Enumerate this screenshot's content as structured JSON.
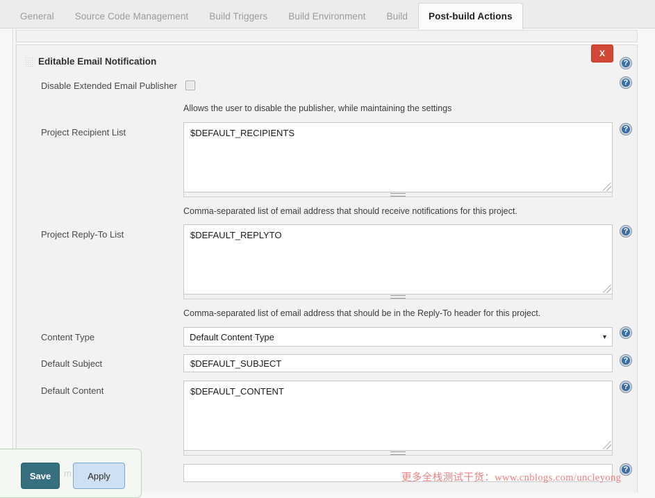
{
  "tabs": [
    {
      "label": "General",
      "active": false
    },
    {
      "label": "Source Code Management",
      "active": false
    },
    {
      "label": "Build Triggers",
      "active": false
    },
    {
      "label": "Build Environment",
      "active": false
    },
    {
      "label": "Build",
      "active": false
    },
    {
      "label": "Post-build Actions",
      "active": true
    }
  ],
  "panel": {
    "title": "Editable Email Notification",
    "delete_label": "X"
  },
  "fields": {
    "disable_publisher": {
      "label": "Disable Extended Email Publisher",
      "checked": false,
      "description": "Allows the user to disable the publisher, while maintaining the settings"
    },
    "project_recipient_list": {
      "label": "Project Recipient List",
      "value": "$DEFAULT_RECIPIENTS",
      "description": "Comma-separated list of email address that should receive notifications for this project."
    },
    "project_reply_to_list": {
      "label": "Project Reply-To List",
      "value": "$DEFAULT_REPLYTO",
      "description": "Comma-separated list of email address that should be in the Reply-To header for this project."
    },
    "content_type": {
      "label": "Content Type",
      "selected": "Default Content Type",
      "arrow": "▼"
    },
    "default_subject": {
      "label": "Default Subject",
      "value": "$DEFAULT_SUBJECT"
    },
    "default_content": {
      "label": "Default Content",
      "value": "$DEFAULT_CONTENT"
    },
    "trailing_input": {
      "value": "",
      "placeholder": ""
    }
  },
  "help_icon_glyph": "?",
  "savebar": {
    "save_label": "Save",
    "apply_label": "Apply",
    "ghost_text": "m"
  },
  "watermark": {
    "text": "更多全栈测试干货：www.cnblogs.com/uncleyong"
  },
  "colors": {
    "accent_save": "#36707f",
    "accent_apply": "#cfe0f2",
    "danger": "#d14836",
    "help_icon": "#3a6ea5",
    "watermark": "#f08080"
  }
}
